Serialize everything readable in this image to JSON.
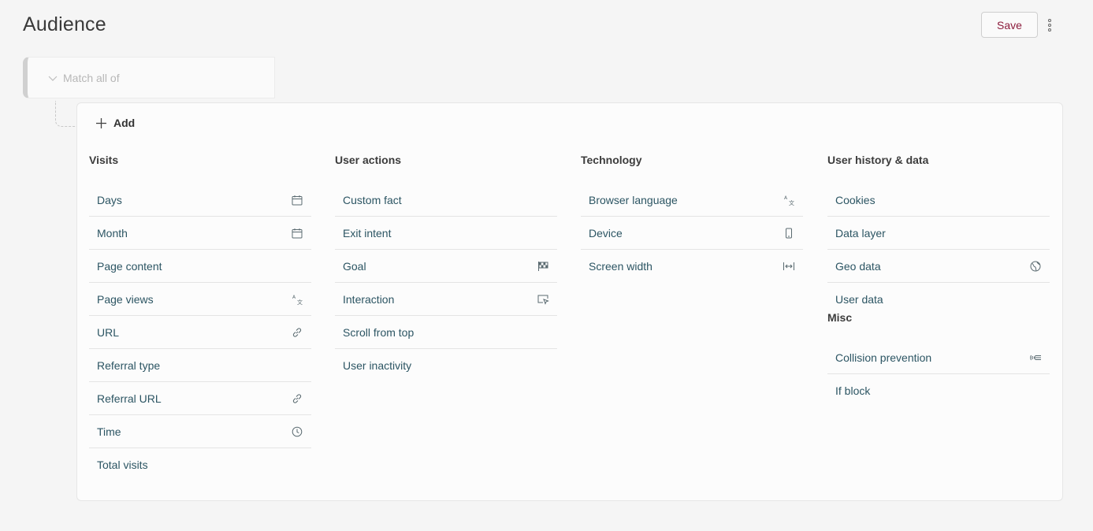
{
  "header": {
    "title": "Audience",
    "save_label": "Save"
  },
  "condition": {
    "match_label": "Match all of"
  },
  "panel": {
    "add_label": "Add",
    "columns": [
      {
        "title": "Visits",
        "items": [
          {
            "label": "Days",
            "icon": "calendar-icon"
          },
          {
            "label": "Month",
            "icon": "calendar-icon"
          },
          {
            "label": "Page content",
            "icon": ""
          },
          {
            "label": "Page views",
            "icon": "translate-icon"
          },
          {
            "label": "URL",
            "icon": "link-icon"
          },
          {
            "label": "Referral type",
            "icon": ""
          },
          {
            "label": "Referral URL",
            "icon": "link-icon"
          },
          {
            "label": "Time",
            "icon": "clock-icon"
          },
          {
            "label": "Total visits",
            "icon": ""
          }
        ]
      },
      {
        "title": "User actions",
        "items": [
          {
            "label": "Custom fact",
            "icon": ""
          },
          {
            "label": "Exit intent",
            "icon": ""
          },
          {
            "label": "Goal",
            "icon": "flag-icon"
          },
          {
            "label": "Interaction",
            "icon": "cursor-window-icon"
          },
          {
            "label": "Scroll from top",
            "icon": ""
          },
          {
            "label": "User inactivity",
            "icon": ""
          }
        ]
      },
      {
        "title": "Technology",
        "items": [
          {
            "label": "Browser language",
            "icon": "translate-icon"
          },
          {
            "label": "Device",
            "icon": "phone-icon"
          },
          {
            "label": "Screen width",
            "icon": "width-icon"
          }
        ]
      },
      {
        "title": "User history & data",
        "items": [
          {
            "label": "Cookies",
            "icon": ""
          },
          {
            "label": "Data layer",
            "icon": ""
          },
          {
            "label": "Geo data",
            "icon": "globe-icon"
          },
          {
            "label": "User data",
            "icon": ""
          }
        ],
        "sub_title": "Misc",
        "sub_items": [
          {
            "label": "Collision prevention",
            "icon": "collision-icon"
          },
          {
            "label": "If block",
            "icon": ""
          }
        ]
      }
    ]
  }
}
